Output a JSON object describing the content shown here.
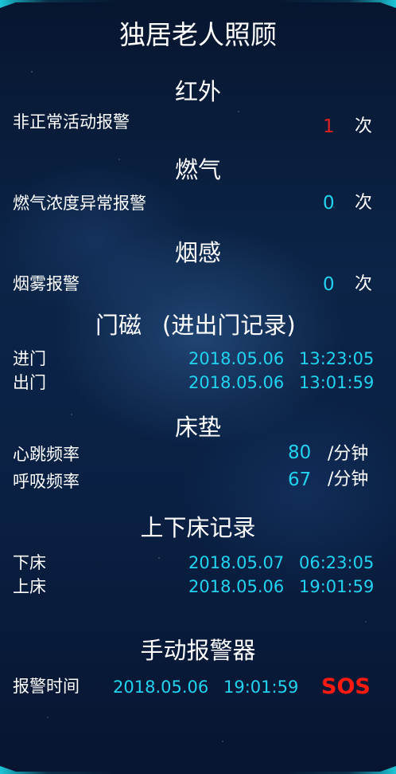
{
  "title": "独居老人照顾",
  "infrared": {
    "heading": "红外",
    "label": "非正常活动报警",
    "count": "1",
    "unit": "次",
    "count_color": "#e0201e"
  },
  "gas": {
    "heading": "燃气",
    "label": "燃气浓度异常报警",
    "count": "0",
    "unit": "次"
  },
  "smoke": {
    "heading": "烟感",
    "label": "烟雾报警",
    "count": "0",
    "unit": "次"
  },
  "door": {
    "heading": "门磁",
    "subheading": "(进出门记录)",
    "rows": [
      {
        "label": "进门",
        "date": "2018.05.06",
        "time": "13:23:05"
      },
      {
        "label": "出门",
        "date": "2018.05.06",
        "time": "13:01:59"
      }
    ]
  },
  "mattress": {
    "heading": "床垫",
    "rows": [
      {
        "label": "心跳频率",
        "value": "80",
        "unit": "/分钟"
      },
      {
        "label": "呼吸频率",
        "value": "67",
        "unit": "/分钟"
      }
    ]
  },
  "bed": {
    "heading": "上下床记录",
    "rows": [
      {
        "label": "下床",
        "date": "2018.05.07",
        "time": "06:23:05"
      },
      {
        "label": "上床",
        "date": "2018.05.06",
        "time": "19:01:59"
      }
    ]
  },
  "manual_alarm": {
    "heading": "手动报警器",
    "label": "报警时间",
    "date": "2018.05.06",
    "time": "19:01:59",
    "sos_label": "SOS"
  },
  "colors": {
    "accent": "#22d3f0",
    "alert": "#e0201e",
    "sos": "#ff1a10",
    "frame": "#1cc6d6"
  }
}
